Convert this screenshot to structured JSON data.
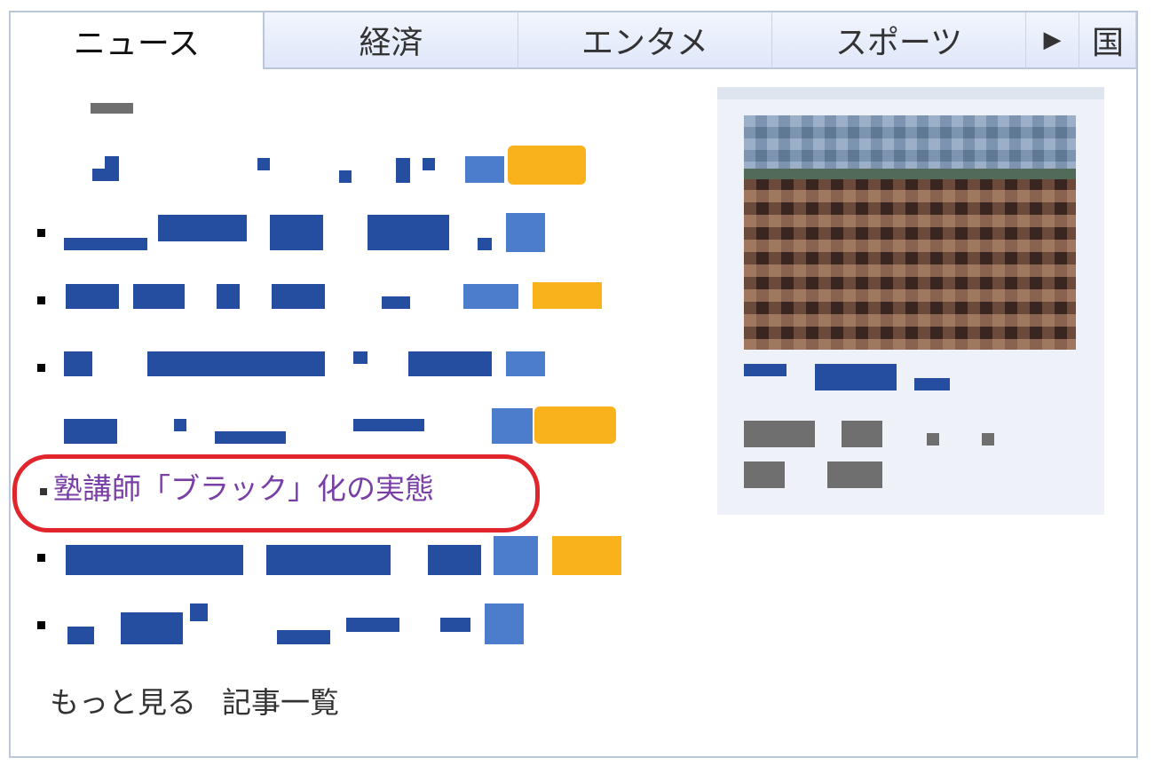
{
  "tabs": [
    {
      "label": "ニュース",
      "active": true
    },
    {
      "label": "経済",
      "active": false
    },
    {
      "label": "エンタメ",
      "active": false
    },
    {
      "label": "スポーツ",
      "active": false
    },
    {
      "label": "国",
      "active": false
    }
  ],
  "tab_more_icon": "right-triangle-icon",
  "headline": {
    "text": "塾講師「ブラック」化の実態"
  },
  "footer": {
    "more": "もっと見る",
    "list": "記事一覧"
  },
  "colors": {
    "link": "#264ea0",
    "visited": "#7a3fa6",
    "highlight_ring": "#e0262c",
    "tab_border": "#b9c7d8"
  }
}
